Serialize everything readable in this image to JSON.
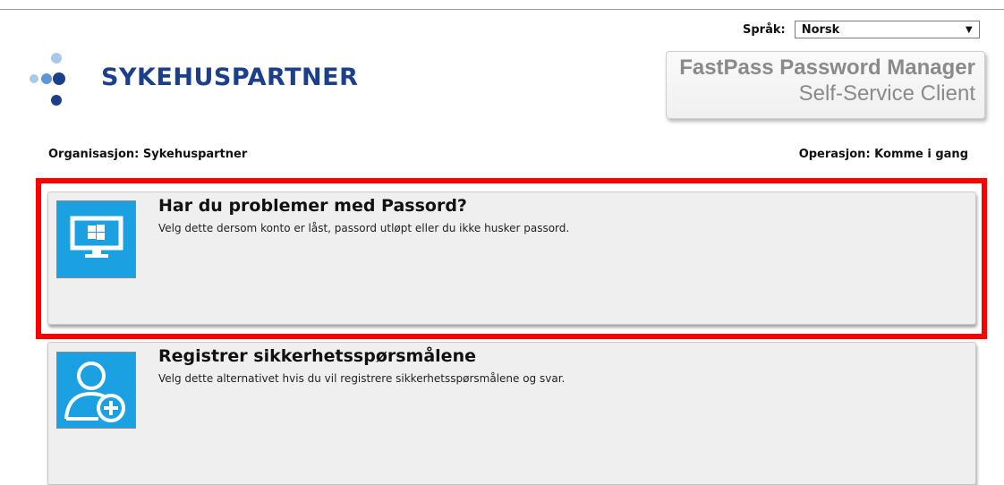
{
  "header": {
    "language_label": "Språk:",
    "language_selected": "Norsk",
    "logo_text": "SYKEHUSPARTNER",
    "product_title": "FastPass Password Manager",
    "product_subtitle": "Self-Service Client"
  },
  "info": {
    "organization": "Organisasjon: Sykehuspartner",
    "operation": "Operasjon: Komme i gang"
  },
  "options": [
    {
      "title": "Har du problemer med Passord?",
      "description": "Velg dette dersom konto er låst, passord utløpt eller du ikke husker passord.",
      "icon": "windows-monitor-icon"
    },
    {
      "title": "Registrer sikkerhetsspørsmålene",
      "description": "Velg dette alternativet hvis du vil registrere sikkerhetsspørsmålene og svar.",
      "icon": "user-add-icon"
    }
  ],
  "colors": {
    "tile_blue": "#1ba1e2",
    "logo_blue": "#1c3f8b",
    "highlight_red": "#ff0000"
  }
}
